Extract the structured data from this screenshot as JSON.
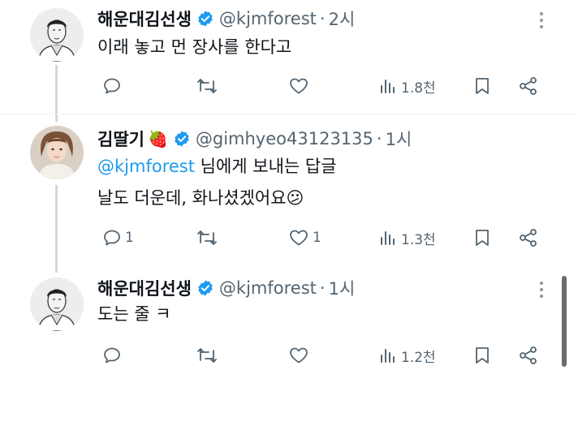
{
  "tweets": [
    {
      "author_name": "해운대김선생",
      "handle": "@kjmforest",
      "separator": "·",
      "time": "2시",
      "text": "이래 놓고 먼 장사를 한다고",
      "replies": "",
      "retweets": "",
      "likes": "",
      "views": "1.8천"
    },
    {
      "author_name": "김딸기",
      "name_emoji": "🍓",
      "handle": "@gimhyeo43123135",
      "separator": "·",
      "time": "1시",
      "reply_to_mention": "@kjmforest",
      "reply_to_suffix": " 님에게 보내는 답글",
      "text": "날도 더운데, 화나셨겠어요😕",
      "replies": "1",
      "retweets": "",
      "likes": "1",
      "views": "1.3천"
    },
    {
      "author_name": "해운대김선생",
      "handle": "@kjmforest",
      "separator": "·",
      "time": "1시",
      "text": "도는 줄 ㅋ",
      "replies": "",
      "retweets": "",
      "likes": "",
      "views": "1.2천"
    }
  ],
  "icons": {
    "verified": "verified-badge-icon",
    "more": "more-vertical-icon",
    "reply": "reply-icon",
    "retweet": "retweet-icon",
    "like": "heart-icon",
    "views": "views-chart-icon",
    "bookmark": "bookmark-icon",
    "share": "share-icon"
  },
  "colors": {
    "accent": "#1d9bf0",
    "muted": "#536471",
    "text": "#0f1419",
    "thread_line": "#cfd9de"
  }
}
